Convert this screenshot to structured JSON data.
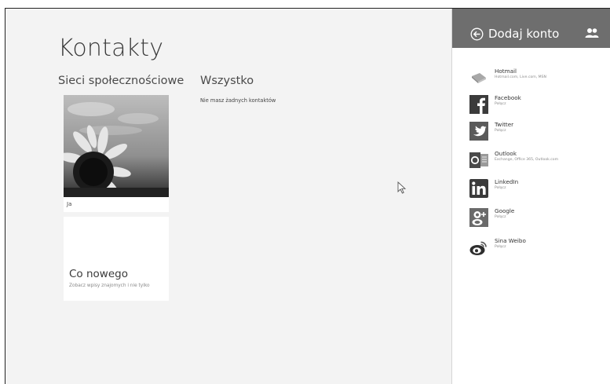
{
  "app": {
    "title": "Kontakty",
    "sections": {
      "social": "Sieci społecznościowe",
      "all": "Wszystko"
    },
    "empty_message": "Nie masz żadnych kontaktów"
  },
  "tiles": {
    "me": {
      "label": "Ja"
    },
    "whats_new": {
      "title": "Co nowego",
      "subtitle": "Zobacz wpisy znajomych i nie tylko"
    }
  },
  "pane": {
    "title": "Dodaj konto",
    "accounts": [
      {
        "name": "Hotmail",
        "desc": "Hotmail.com, Live.com, MSN",
        "icon": "hotmail-icon"
      },
      {
        "name": "Facebook",
        "desc": "Połącz",
        "icon": "facebook-icon"
      },
      {
        "name": "Twitter",
        "desc": "Połącz",
        "icon": "twitter-icon"
      },
      {
        "name": "Outlook",
        "desc": "Exchange, Office 365, Outlook.com",
        "icon": "outlook-icon"
      },
      {
        "name": "LinkedIn",
        "desc": "Połącz",
        "icon": "linkedin-icon"
      },
      {
        "name": "Google",
        "desc": "Połącz",
        "icon": "google-icon"
      },
      {
        "name": "Sina Weibo",
        "desc": "Połącz",
        "icon": "sina-weibo-icon"
      }
    ]
  },
  "colors": {
    "pane_header": "#6e6e6e",
    "app_background": "#f3f3f3",
    "pane_background": "#ffffff"
  }
}
